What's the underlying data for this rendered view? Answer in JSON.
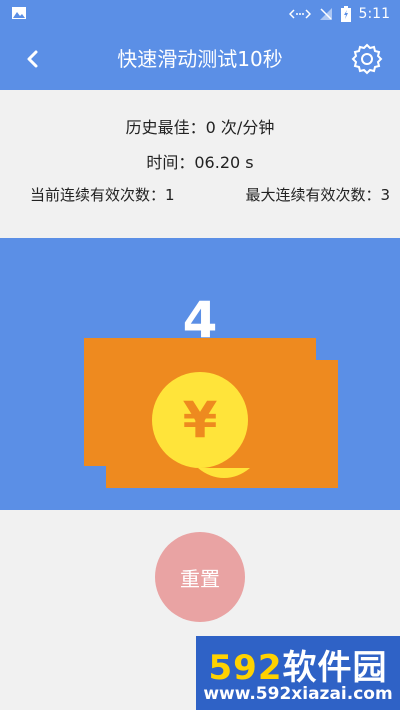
{
  "status_bar": {
    "time": "5:11"
  },
  "app_bar": {
    "title": "快速滑动测试10秒"
  },
  "stats": {
    "best": "历史最佳：0 次/分钟",
    "time": "时间：06.20 s",
    "current_streak": "当前连续有效次数：1",
    "max_streak": "最大连续有效次数：3"
  },
  "game": {
    "counter": "4",
    "coin_symbol": "¥"
  },
  "controls": {
    "reset_label": "重置"
  },
  "watermark": {
    "logo_num": "592",
    "logo_text": "软件园",
    "url": "www.592xiazai.com"
  },
  "colors": {
    "primary": "#5b8fe6",
    "bill": "#ee8a1f",
    "coin": "#ffe43a",
    "reset": "#e9a3a3",
    "watermark_bg": "#2f62c6"
  }
}
